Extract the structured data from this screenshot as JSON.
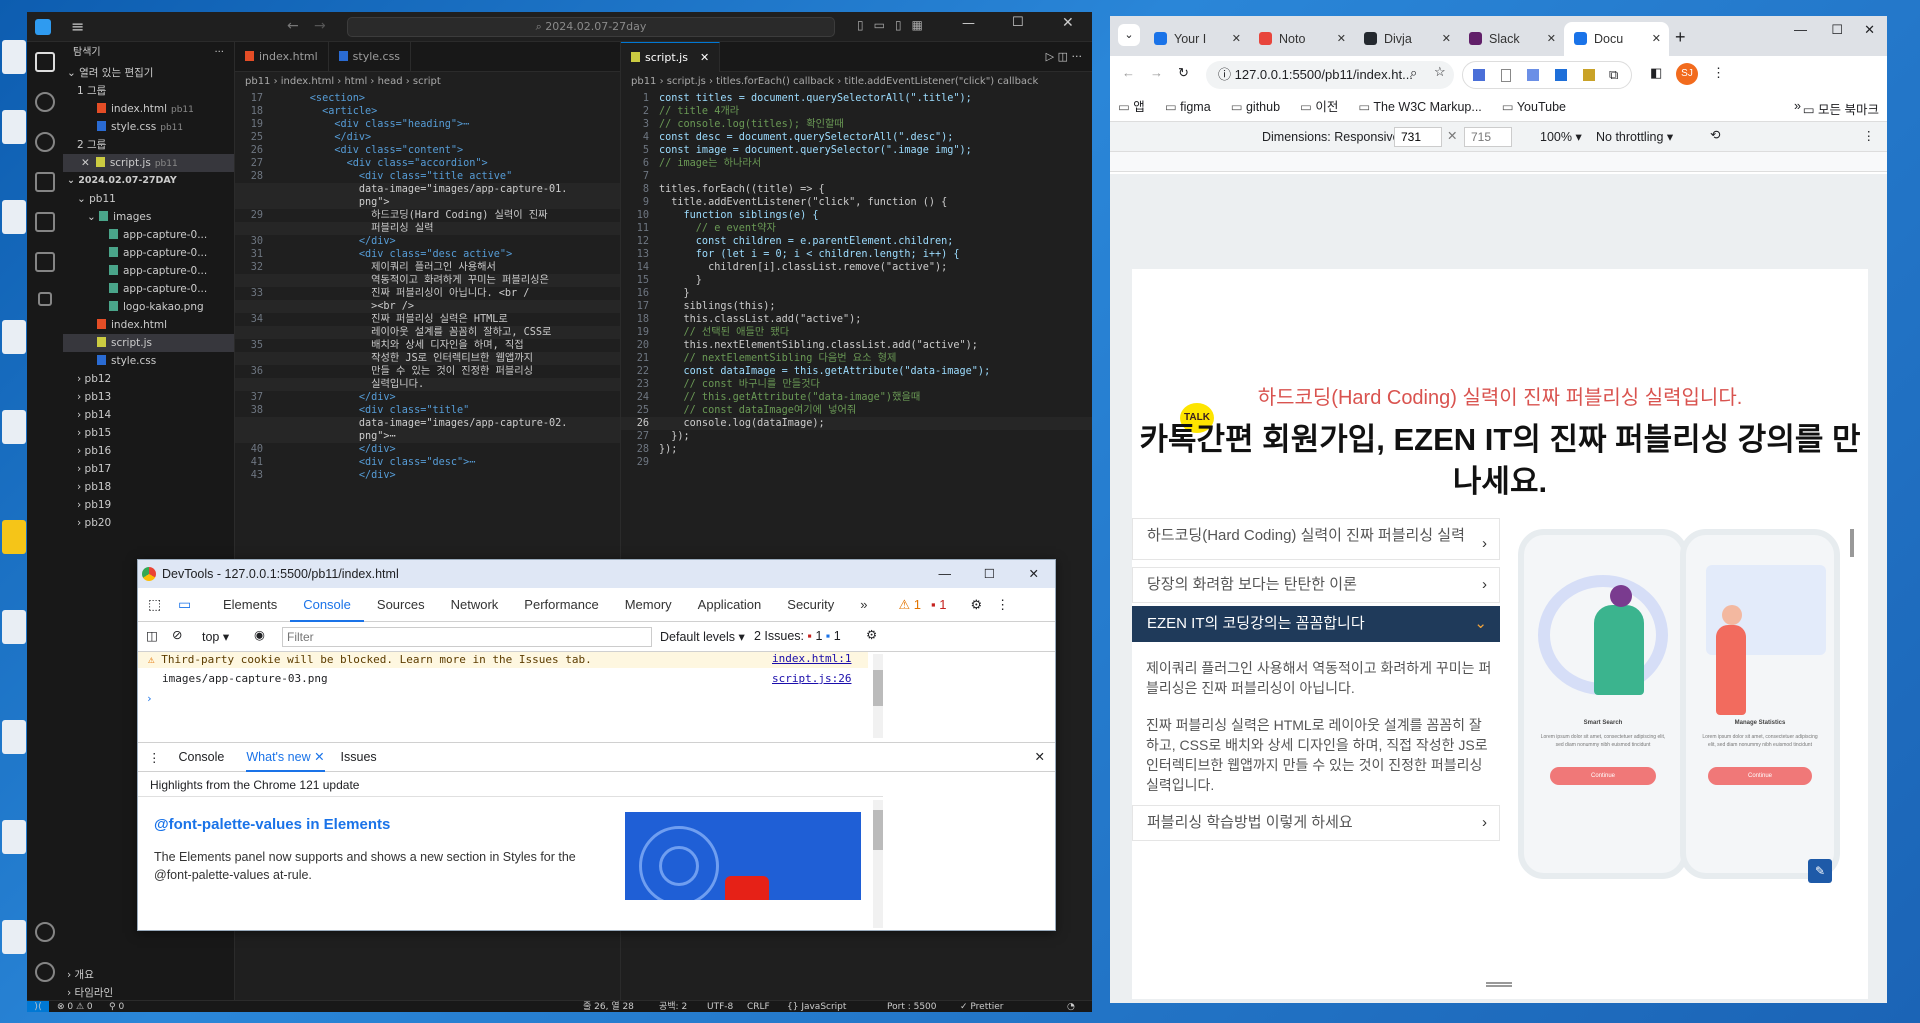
{
  "vscode": {
    "search": "2024.02.07-27day",
    "explorer": {
      "header": "탐색기",
      "open_editors_header": "열려 있는 편집기",
      "group1": "1 그룹",
      "group1_files": [
        {
          "name": "index.html",
          "dir": "pb11"
        },
        {
          "name": "style.css",
          "dir": "pb11"
        }
      ],
      "group2": "2 그룹",
      "group2_files": [
        {
          "name": "script.js",
          "dir": "pb11"
        }
      ],
      "project": "2024.02.07-27DAY",
      "pb11": "pb11",
      "images": "images",
      "image_files": [
        "app-capture-0...",
        "app-capture-0...",
        "app-capture-0...",
        "app-capture-0...",
        "logo-kakao.png"
      ],
      "pb11_files": [
        "index.html",
        "script.js",
        "style.css"
      ],
      "folders": [
        "pb12",
        "pb13",
        "pb14",
        "pb15",
        "pb16",
        "pb17",
        "pb18",
        "pb19",
        "pb20"
      ],
      "outline": "개요",
      "timeline": "타임라인"
    },
    "editor1": {
      "tabs": [
        "index.html",
        "style.css"
      ],
      "breadcrumb": "pb11 › index.html › html › head › script",
      "lines": [
        {
          "n": "17",
          "t": "      <section>"
        },
        {
          "n": "18",
          "t": "        <article>"
        },
        {
          "n": "19",
          "t": "          <div class=\"heading\">⋯"
        },
        {
          "n": "25",
          "t": "          </div>"
        },
        {
          "n": "26",
          "t": "          <div class=\"content\">"
        },
        {
          "n": "27",
          "t": "            <div class=\"accordion\">"
        },
        {
          "n": "28",
          "t": "              <div class=\"title active\""
        },
        {
          "n": "",
          "t": "              data-image=\"images/app-capture-01."
        },
        {
          "n": "",
          "t": "              png\">"
        },
        {
          "n": "29",
          "t": "                하드코딩(Hard Coding) 실력이 진짜"
        },
        {
          "n": "",
          "t": "                퍼블리싱 실력"
        },
        {
          "n": "30",
          "t": "              </div>"
        },
        {
          "n": "31",
          "t": "              <div class=\"desc active\">"
        },
        {
          "n": "32",
          "t": "                제이쿼리 플러그인 사용해서"
        },
        {
          "n": "",
          "t": "                역동적이고 화려하게 꾸미는 퍼블리싱은"
        },
        {
          "n": "33",
          "t": "                진짜 퍼블리싱이 아닙니다. <br /"
        },
        {
          "n": "",
          "t": "                ><br />"
        },
        {
          "n": "34",
          "t": "                진짜 퍼블리싱 실력은 HTML로"
        },
        {
          "n": "",
          "t": "                레이아웃 설계를 꼼꼼히 잘하고, CSS로"
        },
        {
          "n": "35",
          "t": "                배치와 상세 디자인을 하며, 직접"
        },
        {
          "n": "",
          "t": "                작성한 JS로 인터렉티브한 웹앱까지"
        },
        {
          "n": "36",
          "t": "                만들 수 있는 것이 진정한 퍼블리싱"
        },
        {
          "n": "",
          "t": "                실력입니다."
        },
        {
          "n": "37",
          "t": "              </div>"
        },
        {
          "n": "38",
          "t": "              <div class=\"title\""
        },
        {
          "n": "",
          "t": "              data-image=\"images/app-capture-02."
        },
        {
          "n": "",
          "t": "              png\">⋯"
        },
        {
          "n": "40",
          "t": "              </div>"
        },
        {
          "n": "41",
          "t": "              <div class=\"desc\">⋯"
        },
        {
          "n": "43",
          "t": "              </div>"
        }
      ]
    },
    "editor2": {
      "tab": "script.js",
      "breadcrumb": "pb11 › script.js › titles.forEach() callback › title.addEventListener(\"click\") callback",
      "lines": [
        {
          "n": "1",
          "t": "const titles = document.querySelectorAll(\".title\");"
        },
        {
          "n": "2",
          "t": "// title 4개라"
        },
        {
          "n": "3",
          "t": "// console.log(titles); 확인할때"
        },
        {
          "n": "4",
          "t": "const desc = document.querySelectorAll(\".desc\");"
        },
        {
          "n": "5",
          "t": "const image = document.querySelector(\".image img\");"
        },
        {
          "n": "6",
          "t": "// image는 하나라서"
        },
        {
          "n": "7",
          "t": ""
        },
        {
          "n": "8",
          "t": "titles.forEach((title) => {"
        },
        {
          "n": "9",
          "t": "  title.addEventListener(\"click\", function () {"
        },
        {
          "n": "10",
          "t": "    function siblings(e) {"
        },
        {
          "n": "11",
          "t": "      // e event약자"
        },
        {
          "n": "12",
          "t": "      const children = e.parentElement.children;"
        },
        {
          "n": "13",
          "t": "      for (let i = 0; i < children.length; i++) {"
        },
        {
          "n": "14",
          "t": "        children[i].classList.remove(\"active\");"
        },
        {
          "n": "15",
          "t": "      }"
        },
        {
          "n": "16",
          "t": "    }"
        },
        {
          "n": "17",
          "t": "    siblings(this);"
        },
        {
          "n": "18",
          "t": "    this.classList.add(\"active\");"
        },
        {
          "n": "19",
          "t": "    // 선택된 애들만 됐다"
        },
        {
          "n": "20",
          "t": "    this.nextElementSibling.classList.add(\"active\");"
        },
        {
          "n": "21",
          "t": "    // nextElementSibling 다음번 요소 형제"
        },
        {
          "n": "22",
          "t": "    const dataImage = this.getAttribute(\"data-image\");"
        },
        {
          "n": "23",
          "t": "    // const 바구니를 만들것다"
        },
        {
          "n": "24",
          "t": "    // this.getAttribute(\"data-image\")했을때"
        },
        {
          "n": "25",
          "t": "    // const dataImage여기에 넣어줘"
        },
        {
          "n": "26",
          "t": "    console.log(dataImage);"
        },
        {
          "n": "27",
          "t": "  });"
        },
        {
          "n": "28",
          "t": "});"
        },
        {
          "n": "29",
          "t": ""
        }
      ]
    },
    "status": {
      "errors": "⊗ 0 ⚠ 0",
      "ports": "⚲ 0",
      "position": "줄 26, 열 28",
      "spaces": "공백: 2",
      "encoding": "UTF-8",
      "eol": "CRLF",
      "language": "{} JavaScript",
      "port": "Port : 5500",
      "prettier": "✓ Prettier"
    }
  },
  "devtools": {
    "title": "DevTools - 127.0.0.1:5500/pb11/index.html",
    "tabs": [
      "Elements",
      "Console",
      "Sources",
      "Network",
      "Performance",
      "Memory",
      "Application",
      "Security"
    ],
    "active_tab": "Console",
    "warn_count": "1",
    "issue_count": "1",
    "context": "top",
    "filter_placeholder": "Filter",
    "levels": "Default levels",
    "issues_label": "2 Issues:",
    "issues_warn": "1",
    "issues_info": "1",
    "messages": [
      {
        "text": "Third-party cookie will be blocked. Learn more in the Issues tab.",
        "source": "index.html:1",
        "type": "warning"
      },
      {
        "text": "images/app-capture-03.png",
        "source": "script.js:26",
        "type": "log"
      }
    ],
    "drawer_tabs": [
      "Console",
      "What's new",
      "Issues"
    ],
    "drawer_active": "What's new",
    "whats_new_header": "Highlights from the Chrome 121 update",
    "article_title": "@font-palette-values in Elements",
    "article_text": "The Elements panel now supports and shows a new section in Styles for the @font-palette-values at-rule."
  },
  "chrome": {
    "tabs": [
      "Your I",
      "Noto",
      "Divja",
      "Slack",
      "Docu"
    ],
    "active_tab_index": 4,
    "url": "127.0.0.1:5500/pb11/index.ht...",
    "profile": "SJ",
    "bookmarks": [
      "앱",
      "figma",
      "github",
      "이전",
      "The W3C Markup...",
      "YouTube"
    ],
    "all_bookmarks": "모든 북마크",
    "device": {
      "mode": "Dimensions: Responsive",
      "width": "731",
      "height": "715",
      "zoom": "100%",
      "throttle": "No throttling"
    },
    "page": {
      "subtitle": "하드코딩(Hard Coding) 실력이 진짜 퍼블리싱 실력입니다.",
      "talk_badge": "TALK",
      "heading": "카톡간편 회원가입, EZEN IT의 진짜 퍼블리싱 강의를 만나세요.",
      "accordion": [
        {
          "title": "하드코딩(Hard Coding) 실력이 진짜 퍼블리싱 실력",
          "active": false
        },
        {
          "title": "당장의 화려함 보다는 탄탄한 이론",
          "active": false
        },
        {
          "title": "EZEN IT의 코딩강의는 꼼꼼합니다",
          "active": true
        },
        {
          "title": "퍼블리싱 학습방법 이렇게 하세요",
          "active": false
        }
      ],
      "desc_p1": "제이쿼리 플러그인 사용해서 역동적이고 화려하게 꾸미는 퍼블리싱은 진짜 퍼블리싱이 아닙니다.",
      "desc_p2": "진짜 퍼블리싱 실력은 HTML로 레이아웃 설계를 꼼꼼히 잘하고, CSS로 배치와 상세 디자인을 하며, 직접 작성한 JS로 인터렉티브한 웹앱까지 만들 수 있는 것이 진정한 퍼블리싱 실력입니다.",
      "phone1": {
        "title": "Smart Search",
        "text": "Lorem ipsum dolor sit amet, consectetuer adipiscing elit, sed diam nonummy nibh euismod tincidunt",
        "button": "Continue"
      },
      "phone2": {
        "title": "Manage Statistics",
        "text": "Lorem ipsum dolor sit amet, consectetuer adipiscing elit, sed diam nonummy nibh euismod tincidunt",
        "button": "Continue"
      }
    }
  },
  "colors": {
    "accent": "#0078d4",
    "subtitle": "#d9534f",
    "active_acc": "#1f3a5a",
    "kakao": "#fee500"
  }
}
